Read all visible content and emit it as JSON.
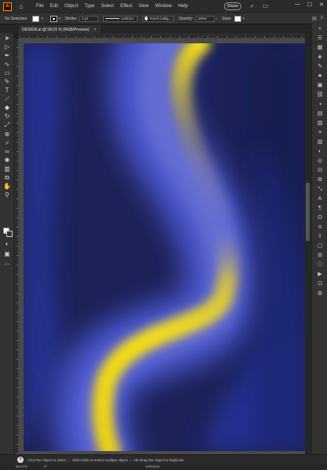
{
  "app": {
    "logo_text": "Ai"
  },
  "menu": {
    "items": [
      "File",
      "Edit",
      "Object",
      "Type",
      "Select",
      "Effect",
      "View",
      "Window",
      "Help"
    ],
    "share_label": "Share"
  },
  "window_controls": {
    "minimize": "—",
    "maximize": "☐",
    "close": "✕"
  },
  "controlbar": {
    "selection_label": "No Selection",
    "stroke_label": "Stroke:",
    "stroke_weight": "1 pt",
    "variable_width_profile": "Uniform",
    "brush_definition": "Touch Callig...",
    "opacity_label": "Opacity:",
    "opacity_value": "100%",
    "style_label": "Style:"
  },
  "document_tab": {
    "title": "DESIGN.ai @ 58,01 % (RGB/Preview)",
    "close_glyph": "×"
  },
  "statusbar": {
    "help_glyph": "?",
    "hint_1": "Click the object to select",
    "hint_2": "Shift+Click to select multiple object",
    "hint_3": "Alt+Drag the object to duplicate",
    "zoom": "58,01%",
    "rotation": "0°",
    "selection_tool": "Selection"
  },
  "colors": {
    "artboard_base": "#1a1f52",
    "blue": "#2f3db0",
    "lavender": "#6b72d6",
    "yellow": "#f3dc1a"
  },
  "icons": {
    "left_tools": [
      "selection-tool-icon",
      "direct-selection-tool-icon",
      "magic-wand-tool-icon",
      "pen-tool-icon",
      "curvature-tool-icon",
      "rectangle-tool-icon",
      "paintbrush-tool-icon",
      "pencil-tool-icon",
      "type-tool-icon",
      "line-tool-icon",
      "eraser-tool-icon",
      "rotate-tool-icon",
      "scale-tool-icon",
      "width-tool-icon",
      "shape-builder-tool-icon",
      "gradient-tool-icon",
      "eyedropper-tool-icon",
      "blend-tool-icon",
      "symbol-sprayer-tool-icon",
      "column-graph-tool-icon",
      "artboard-tool-icon",
      "slice-tool-icon",
      "hand-tool-icon",
      "zoom-tool-icon"
    ],
    "right_panels": [
      "properties-icon",
      "libraries-icon",
      "layers-icon",
      "brushes-icon",
      "symbols-icon",
      "graphic-styles-icon",
      "links-icon",
      "color-icon",
      "swatches-icon",
      "color-guide-icon",
      "stroke-icon",
      "gradient-icon",
      "transparency-icon",
      "appearance-icon",
      "align-icon",
      "pathfinder-icon",
      "transform-icon",
      "character-icon",
      "paragraph-icon",
      "opentype-icon",
      "glyphs-icon",
      "asset-export-icon",
      "artboards-icon",
      "navigator-icon",
      "info-icon",
      "actions-icon",
      "variables-icon",
      "image-trace-icon",
      "document-info-icon"
    ]
  }
}
